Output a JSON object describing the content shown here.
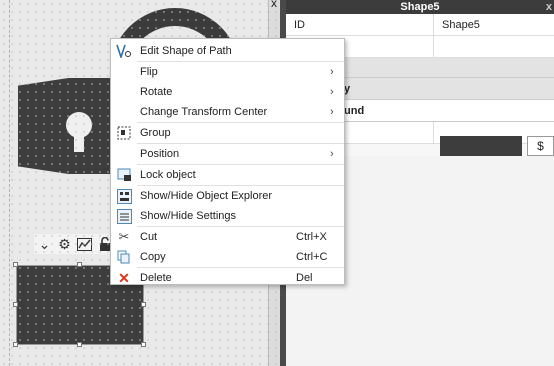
{
  "panel": {
    "title": "Shape5",
    "close": "x",
    "id_label": "ID",
    "id_value": "Shape5",
    "section1": "y",
    "section2": "und",
    "color_button": "$"
  },
  "canvas": {
    "close": "x"
  },
  "menu": {
    "items": [
      {
        "label": "Edit Shape of Path",
        "shortcut": "",
        "submenu": false,
        "icon": "edit-path-icon"
      },
      {
        "label": "Flip",
        "shortcut": "",
        "submenu": true,
        "icon": ""
      },
      {
        "label": "Rotate",
        "shortcut": "",
        "submenu": true,
        "icon": ""
      },
      {
        "label": "Change Transform Center",
        "shortcut": "",
        "submenu": true,
        "icon": ""
      },
      {
        "label": "Group",
        "shortcut": "",
        "submenu": false,
        "icon": "group-icon"
      },
      {
        "label": "Position",
        "shortcut": "",
        "submenu": true,
        "icon": ""
      },
      {
        "label": "Lock object",
        "shortcut": "",
        "submenu": false,
        "icon": "lock-object-icon"
      },
      {
        "label": "Show/Hide Object Explorer",
        "shortcut": "",
        "submenu": false,
        "icon": "object-explorer-icon"
      },
      {
        "label": "Show/Hide Settings",
        "shortcut": "",
        "submenu": false,
        "icon": "settings-panel-icon"
      },
      {
        "label": "Cut",
        "shortcut": "Ctrl+X",
        "submenu": false,
        "icon": "scissors-icon"
      },
      {
        "label": "Copy",
        "shortcut": "Ctrl+C",
        "submenu": false,
        "icon": "copy-icon"
      },
      {
        "label": "Delete",
        "shortcut": "Del",
        "submenu": false,
        "icon": "delete-x-icon"
      }
    ],
    "submenu_arrow": "›"
  },
  "colors": {
    "shape_fill": "#3d3d3d",
    "delete_icon": "#e0341f",
    "panel_header": "#3c3c3c"
  }
}
